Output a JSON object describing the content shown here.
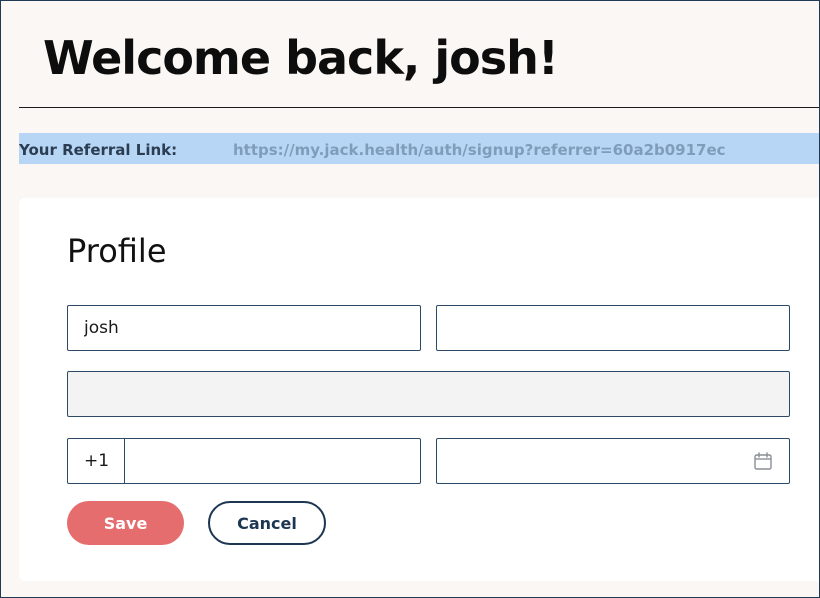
{
  "header": {
    "welcome": "Welcome back, josh!"
  },
  "referral": {
    "label": "Your Referral Link:",
    "url": "https://my.jack.health/auth/signup?referrer=60a2b0917ec"
  },
  "profile": {
    "title": "Profile",
    "first_name": "josh",
    "last_name": "",
    "email": "",
    "country_code": "+1",
    "phone": "",
    "birth_date": ""
  },
  "actions": {
    "save_label": "Save",
    "cancel_label": "Cancel"
  },
  "colors": {
    "background": "#fbf7f5",
    "referral_highlight": "#b7d6f5",
    "field_border": "#2d4a66",
    "save_button": "#e66d6d",
    "cancel_border": "#1d3652"
  },
  "icons": {
    "date_picker": "calendar-icon"
  }
}
